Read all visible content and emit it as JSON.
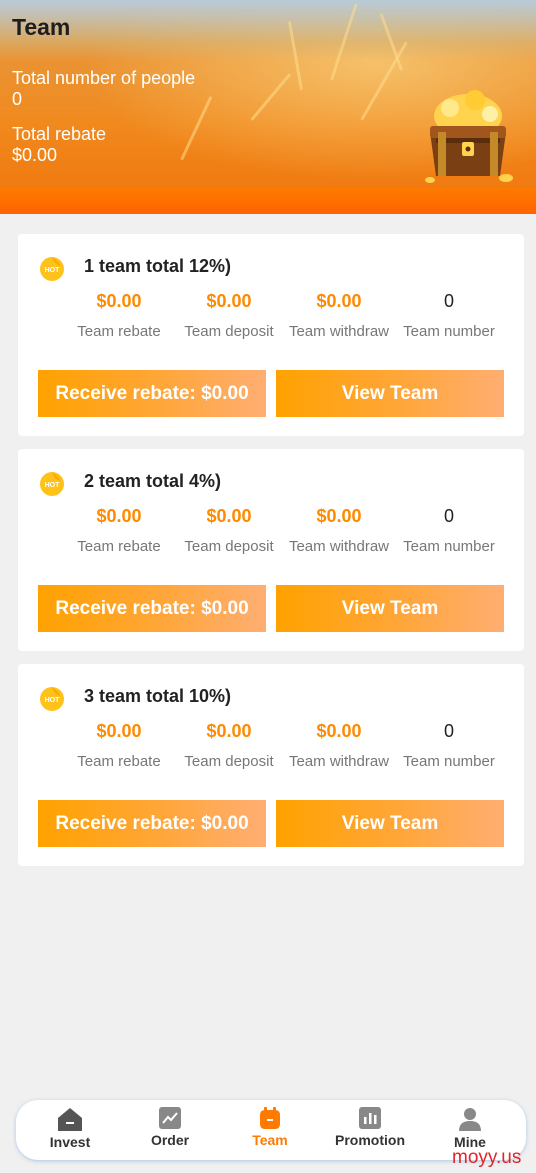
{
  "header": {
    "title": "Team",
    "total_people_label": "Total number of people",
    "total_people_value": "0",
    "total_rebate_label": "Total rebate",
    "total_rebate_value": "$0.00"
  },
  "teams": [
    {
      "title": "1 team total 12%)",
      "stats": [
        {
          "value": "$0.00",
          "label": "Team rebate"
        },
        {
          "value": "$0.00",
          "label": "Team deposit"
        },
        {
          "value": "$0.00",
          "label": "Team withdraw"
        },
        {
          "value": "0",
          "label": "Team number"
        }
      ],
      "receive_label": "Receive rebate: $0.00",
      "view_label": "View Team"
    },
    {
      "title": "2 team total 4%)",
      "stats": [
        {
          "value": "$0.00",
          "label": "Team rebate"
        },
        {
          "value": "$0.00",
          "label": "Team deposit"
        },
        {
          "value": "$0.00",
          "label": "Team withdraw"
        },
        {
          "value": "0",
          "label": "Team number"
        }
      ],
      "receive_label": "Receive rebate: $0.00",
      "view_label": "View Team"
    },
    {
      "title": "3 team total 10%)",
      "stats": [
        {
          "value": "$0.00",
          "label": "Team rebate"
        },
        {
          "value": "$0.00",
          "label": "Team deposit"
        },
        {
          "value": "$0.00",
          "label": "Team withdraw"
        },
        {
          "value": "0",
          "label": "Team number"
        }
      ],
      "receive_label": "Receive rebate: $0.00",
      "view_label": "View Team"
    }
  ],
  "tabbar": {
    "items": [
      {
        "label": "Invest",
        "icon": "invest-icon"
      },
      {
        "label": "Order",
        "icon": "order-icon"
      },
      {
        "label": "Team",
        "icon": "team-icon",
        "active": true
      },
      {
        "label": "Promotion",
        "icon": "promotion-icon"
      },
      {
        "label": "Mine",
        "icon": "mine-icon"
      }
    ]
  },
  "hot_badge": "HOT",
  "watermark": "moyy.us",
  "colors": {
    "accent": "#ff8a00",
    "active_tab": "#ff7a00",
    "watermark": "#e0262a"
  }
}
